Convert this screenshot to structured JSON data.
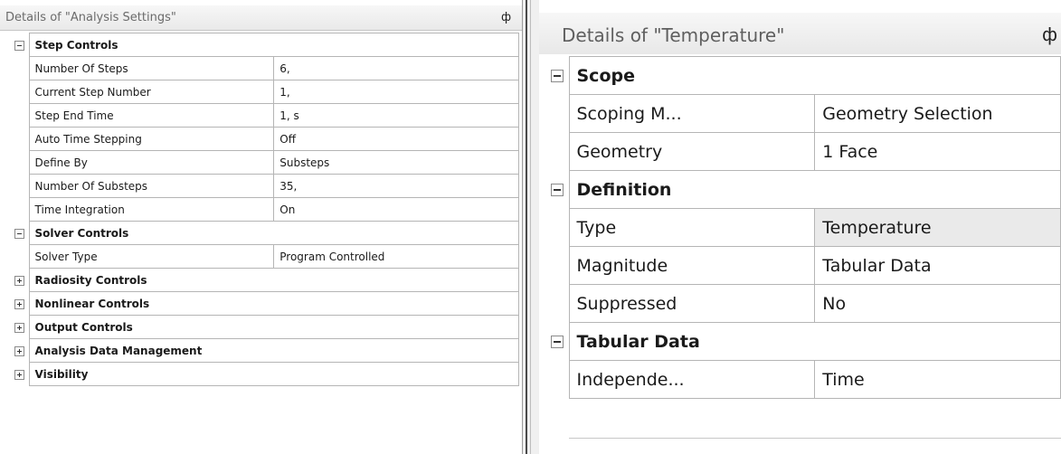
{
  "left_panel": {
    "title": "Details of \"Analysis Settings\"",
    "pin": "ф",
    "rows": [
      {
        "type": "category",
        "label": "Step Controls",
        "expanded": true
      },
      {
        "type": "prop",
        "label": "Number Of Steps",
        "value": "6,"
      },
      {
        "type": "prop",
        "label": "Current Step Number",
        "value": "1,"
      },
      {
        "type": "prop",
        "label": "Step End Time",
        "value": "1, s"
      },
      {
        "type": "prop",
        "label": "Auto Time Stepping",
        "value": "Off"
      },
      {
        "type": "prop",
        "label": "Define By",
        "value": "Substeps"
      },
      {
        "type": "prop",
        "label": "Number Of Substeps",
        "value": "35,"
      },
      {
        "type": "prop",
        "label": "Time Integration",
        "value": "On"
      },
      {
        "type": "category",
        "label": "Solver Controls",
        "expanded": true
      },
      {
        "type": "prop",
        "label": "Solver Type",
        "value": "Program Controlled"
      },
      {
        "type": "category",
        "label": "Radiosity Controls",
        "expanded": false
      },
      {
        "type": "category",
        "label": "Nonlinear Controls",
        "expanded": false
      },
      {
        "type": "category",
        "label": "Output Controls",
        "expanded": false
      },
      {
        "type": "category",
        "label": "Analysis Data Management",
        "expanded": false
      },
      {
        "type": "category",
        "label": "Visibility",
        "expanded": false
      }
    ]
  },
  "right_panel": {
    "title": "Details of \"Temperature\"",
    "pin": "ф",
    "rows": [
      {
        "type": "category",
        "label": "Scope",
        "expanded": true
      },
      {
        "type": "prop",
        "label": "Scoping M...",
        "value": "Geometry Selection"
      },
      {
        "type": "prop",
        "label": "Geometry",
        "value": "1 Face"
      },
      {
        "type": "category",
        "label": "Definition",
        "expanded": true
      },
      {
        "type": "prop",
        "label": "Type",
        "value": "Temperature",
        "highlight": true
      },
      {
        "type": "prop",
        "label": "Magnitude",
        "value": "Tabular Data"
      },
      {
        "type": "prop",
        "label": "Suppressed",
        "value": "No"
      },
      {
        "type": "category",
        "label": "Tabular Data",
        "expanded": true
      },
      {
        "type": "prop",
        "label": "Independe...",
        "value": "Time"
      }
    ]
  }
}
